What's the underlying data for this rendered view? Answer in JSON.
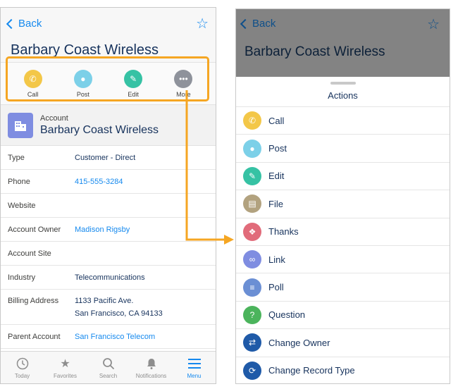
{
  "left": {
    "back_label": "Back",
    "title": "Barbary Coast Wireless",
    "actions": [
      {
        "label": "Call",
        "color": "#f3c748",
        "icon": "phone-icon"
      },
      {
        "label": "Post",
        "color": "#7cd0e8",
        "icon": "chat-icon"
      },
      {
        "label": "Edit",
        "color": "#36c2a4",
        "icon": "pencil-icon"
      },
      {
        "label": "More",
        "color": "#8e929b",
        "icon": "more-icon"
      }
    ],
    "account": {
      "type_label": "Account",
      "name": "Barbary Coast Wireless"
    },
    "fields": [
      {
        "key": "Type",
        "value": "Customer - Direct"
      },
      {
        "key": "Phone",
        "value": "415-555-3284"
      },
      {
        "key": "Website",
        "value": ""
      },
      {
        "key": "Account Owner",
        "value": "Madison Rigsby"
      },
      {
        "key": "Account Site",
        "value": ""
      },
      {
        "key": "Industry",
        "value": "Telecommunications"
      },
      {
        "key": "Billing Address",
        "value_line1": "1133 Pacific Ave.",
        "value_line2": "San Francisco, CA 94133"
      },
      {
        "key": "Parent Account",
        "value": "San Francisco Telecom"
      }
    ],
    "tabs": [
      "Today",
      "Favorites",
      "Search",
      "Notifications",
      "Menu"
    ]
  },
  "right": {
    "back_label": "Back",
    "title": "Barbary Coast Wireless",
    "sheet_title": "Actions",
    "items": [
      {
        "label": "Call",
        "color": "#f3c748",
        "icon": "phone-icon"
      },
      {
        "label": "Post",
        "color": "#7cd0e8",
        "icon": "chat-icon"
      },
      {
        "label": "Edit",
        "color": "#36c2a4",
        "icon": "pencil-icon"
      },
      {
        "label": "File",
        "color": "#b2a27f",
        "icon": "file-icon"
      },
      {
        "label": "Thanks",
        "color": "#e16b7a",
        "icon": "gift-icon"
      },
      {
        "label": "Link",
        "color": "#7f8de1",
        "icon": "link-icon"
      },
      {
        "label": "Poll",
        "color": "#6b8fd4",
        "icon": "poll-icon"
      },
      {
        "label": "Question",
        "color": "#4bb45c",
        "icon": "question-icon"
      },
      {
        "label": "Change Owner",
        "color": "#1f5aa8",
        "icon": "owner-icon"
      },
      {
        "label": "Change Record Type",
        "color": "#1f5aa8",
        "icon": "record-type-icon"
      }
    ]
  },
  "colors": {
    "accent": "#1589ee",
    "highlight": "#f5a623"
  }
}
